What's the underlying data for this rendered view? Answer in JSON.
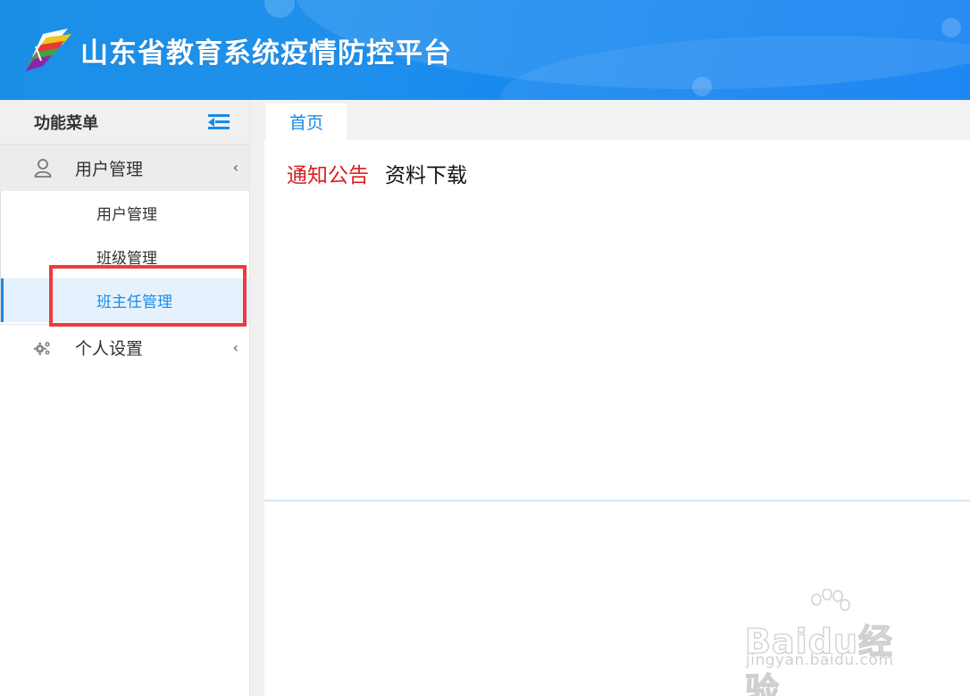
{
  "header": {
    "title": "山东省教育系统疫情防控平台"
  },
  "sidebar": {
    "menu_title": "功能菜单",
    "groups": [
      {
        "label": "用户管理",
        "icon": "user-icon",
        "expanded": true,
        "items": [
          {
            "label": "用户管理",
            "active": false
          },
          {
            "label": "班级管理",
            "active": false
          },
          {
            "label": "班主任管理",
            "active": true
          }
        ]
      },
      {
        "label": "个人设置",
        "icon": "gears-icon",
        "expanded": false
      }
    ]
  },
  "tabs": [
    {
      "label": "首页",
      "active": true
    }
  ],
  "content": {
    "links": [
      {
        "label": "通知公告",
        "color": "#d91f1f"
      },
      {
        "label": "资料下载",
        "color": "#111111"
      }
    ]
  },
  "watermark": {
    "brand": "Baidu经验",
    "url": "jingyan.baidu.com"
  },
  "colors": {
    "accent": "#1a8ae6",
    "header": "#1686f0",
    "highlight_box": "#f23a3a"
  }
}
